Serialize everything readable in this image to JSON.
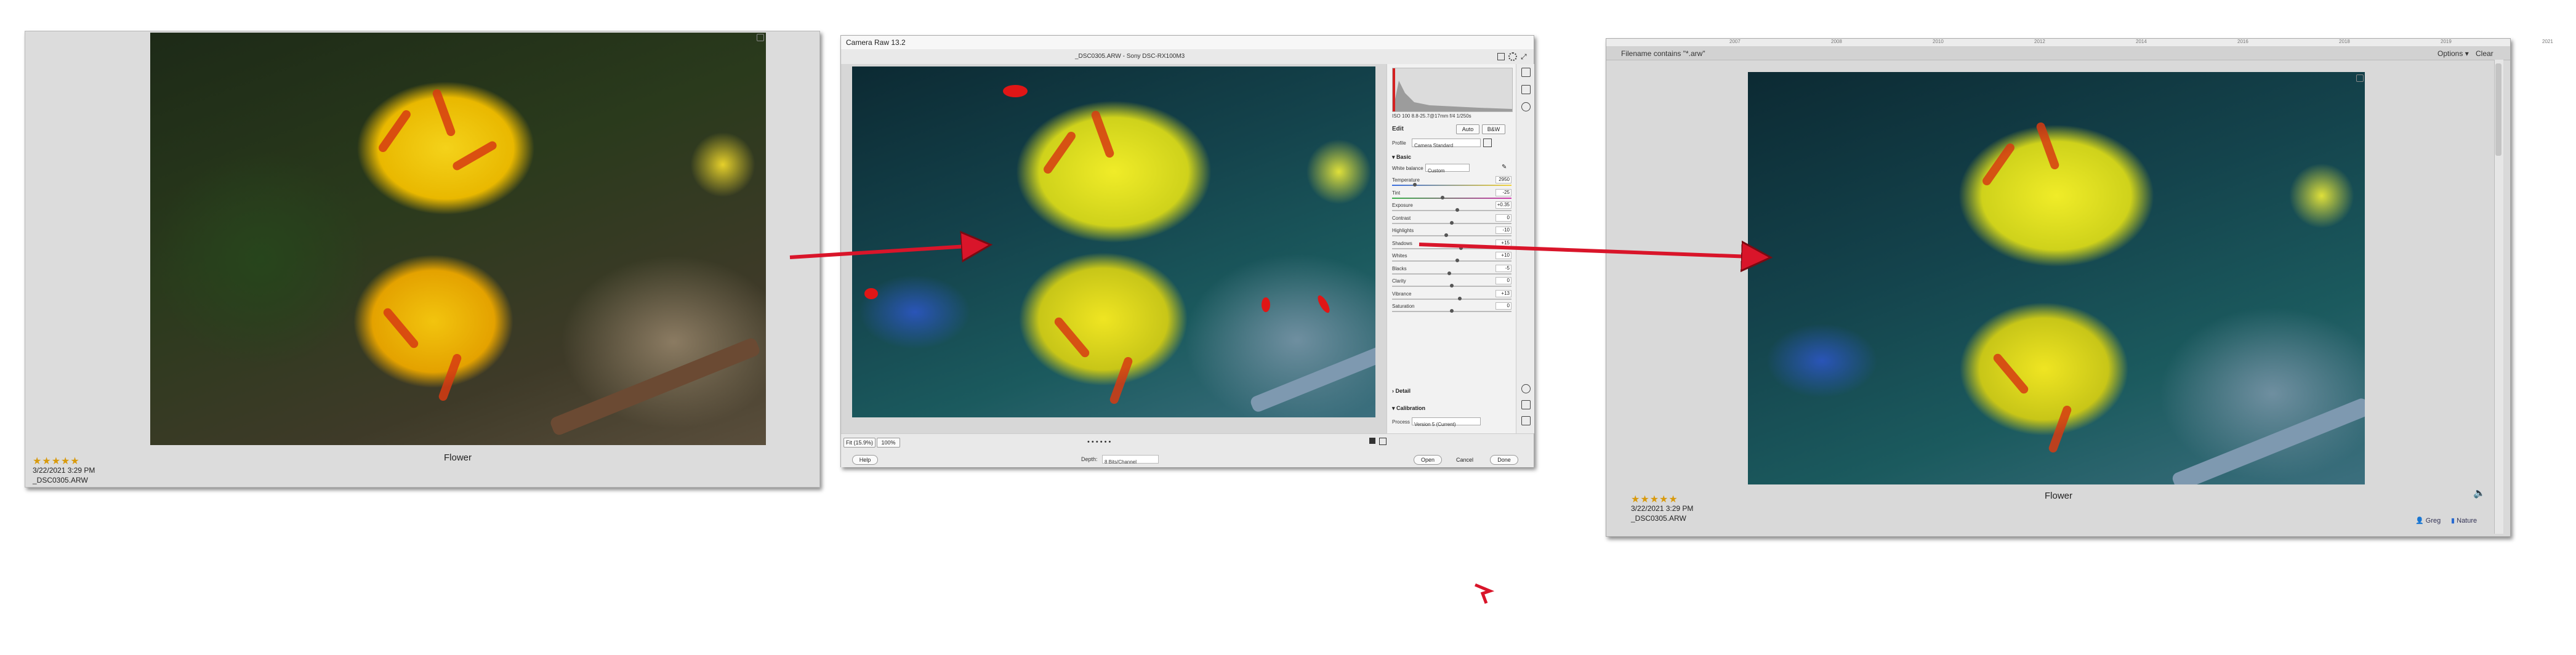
{
  "left_panel": {
    "rating": "★★★★★",
    "date": "3/22/2021 3:29 PM",
    "filename": "_DSC0305.ARW",
    "caption": "Flower"
  },
  "camera_raw": {
    "title": "Camera Raw 13.2",
    "file_info": "_DSC0305.ARW  -  Sony DSC-RX100M3",
    "histogram_info": "ISO 100   8.8-25.7@17mm   f/4   1/250s",
    "tab_edit": "Edit",
    "auto_label": "Auto",
    "bw_label": "B&W",
    "profile_label": "Profile",
    "profile_value": "Camera Standard",
    "section_basic": "Basic",
    "white_balance_label": "White balance",
    "white_balance_value": "Custom",
    "sliders": [
      {
        "label": "Temperature",
        "value": "2950",
        "pos": 0.18
      },
      {
        "label": "Tint",
        "value": "-25",
        "pos": 0.42
      },
      {
        "label": "Exposure",
        "value": "+0.35",
        "pos": 0.55
      },
      {
        "label": "Contrast",
        "value": "0",
        "pos": 0.5
      },
      {
        "label": "Highlights",
        "value": "-10",
        "pos": 0.45
      },
      {
        "label": "Shadows",
        "value": "+15",
        "pos": 0.58
      },
      {
        "label": "Whites",
        "value": "+10",
        "pos": 0.55
      },
      {
        "label": "Blacks",
        "value": "-5",
        "pos": 0.48
      },
      {
        "label": "Clarity",
        "value": "0",
        "pos": 0.5
      },
      {
        "label": "Vibrance",
        "value": "+13",
        "pos": 0.57
      },
      {
        "label": "Saturation",
        "value": "0",
        "pos": 0.5
      }
    ],
    "section_detail": "Detail",
    "section_calibration": "Calibration",
    "process_label": "Process",
    "process_value": "Version 5 (Current)",
    "zoom_fit": "Fit (15.9%)",
    "zoom_100": "100%",
    "rating_dots": "• • • • • •",
    "help_button": "Help",
    "depth_label": "Depth:",
    "depth_value": "8 Bits/Channel",
    "open_button": "Open",
    "cancel_button": "Cancel",
    "done_button": "Done"
  },
  "right_panel": {
    "ruler_ticks": [
      "2007",
      "2008",
      "2010",
      "2012",
      "2014",
      "2016",
      "2018",
      "2019",
      "2021"
    ],
    "filter_text": "Filename contains \"*.arw\"",
    "options_label": "Options ▾",
    "clear_label": "Clear",
    "rating": "★★★★★",
    "date": "3/22/2021 3:29 PM",
    "filename": "_DSC0305.ARW",
    "caption": "Flower",
    "tag_person": "Greg",
    "tag_place": "Nature"
  },
  "colors": {
    "arrow": "#d9152a",
    "star": "#d89a0d",
    "panel_bg": "#dcdcdc"
  }
}
